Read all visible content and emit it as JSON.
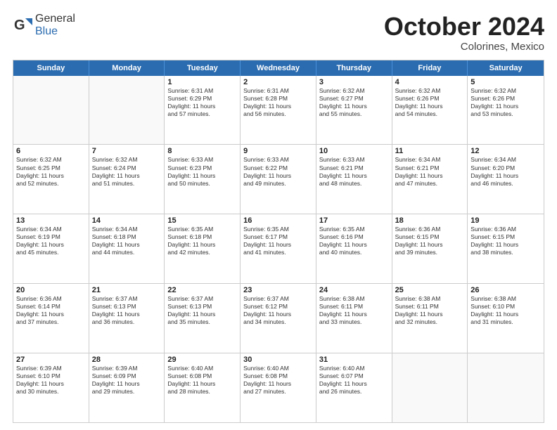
{
  "logo": {
    "general": "General",
    "blue": "Blue"
  },
  "header": {
    "month": "October 2024",
    "location": "Colorines, Mexico"
  },
  "weekdays": [
    "Sunday",
    "Monday",
    "Tuesday",
    "Wednesday",
    "Thursday",
    "Friday",
    "Saturday"
  ],
  "rows": [
    [
      {
        "day": "",
        "empty": true
      },
      {
        "day": "",
        "empty": true
      },
      {
        "day": "1",
        "line1": "Sunrise: 6:31 AM",
        "line2": "Sunset: 6:29 PM",
        "line3": "Daylight: 11 hours",
        "line4": "and 57 minutes."
      },
      {
        "day": "2",
        "line1": "Sunrise: 6:31 AM",
        "line2": "Sunset: 6:28 PM",
        "line3": "Daylight: 11 hours",
        "line4": "and 56 minutes."
      },
      {
        "day": "3",
        "line1": "Sunrise: 6:32 AM",
        "line2": "Sunset: 6:27 PM",
        "line3": "Daylight: 11 hours",
        "line4": "and 55 minutes."
      },
      {
        "day": "4",
        "line1": "Sunrise: 6:32 AM",
        "line2": "Sunset: 6:26 PM",
        "line3": "Daylight: 11 hours",
        "line4": "and 54 minutes."
      },
      {
        "day": "5",
        "line1": "Sunrise: 6:32 AM",
        "line2": "Sunset: 6:26 PM",
        "line3": "Daylight: 11 hours",
        "line4": "and 53 minutes."
      }
    ],
    [
      {
        "day": "6",
        "line1": "Sunrise: 6:32 AM",
        "line2": "Sunset: 6:25 PM",
        "line3": "Daylight: 11 hours",
        "line4": "and 52 minutes."
      },
      {
        "day": "7",
        "line1": "Sunrise: 6:32 AM",
        "line2": "Sunset: 6:24 PM",
        "line3": "Daylight: 11 hours",
        "line4": "and 51 minutes."
      },
      {
        "day": "8",
        "line1": "Sunrise: 6:33 AM",
        "line2": "Sunset: 6:23 PM",
        "line3": "Daylight: 11 hours",
        "line4": "and 50 minutes."
      },
      {
        "day": "9",
        "line1": "Sunrise: 6:33 AM",
        "line2": "Sunset: 6:22 PM",
        "line3": "Daylight: 11 hours",
        "line4": "and 49 minutes."
      },
      {
        "day": "10",
        "line1": "Sunrise: 6:33 AM",
        "line2": "Sunset: 6:21 PM",
        "line3": "Daylight: 11 hours",
        "line4": "and 48 minutes."
      },
      {
        "day": "11",
        "line1": "Sunrise: 6:34 AM",
        "line2": "Sunset: 6:21 PM",
        "line3": "Daylight: 11 hours",
        "line4": "and 47 minutes."
      },
      {
        "day": "12",
        "line1": "Sunrise: 6:34 AM",
        "line2": "Sunset: 6:20 PM",
        "line3": "Daylight: 11 hours",
        "line4": "and 46 minutes."
      }
    ],
    [
      {
        "day": "13",
        "line1": "Sunrise: 6:34 AM",
        "line2": "Sunset: 6:19 PM",
        "line3": "Daylight: 11 hours",
        "line4": "and 45 minutes."
      },
      {
        "day": "14",
        "line1": "Sunrise: 6:34 AM",
        "line2": "Sunset: 6:18 PM",
        "line3": "Daylight: 11 hours",
        "line4": "and 44 minutes."
      },
      {
        "day": "15",
        "line1": "Sunrise: 6:35 AM",
        "line2": "Sunset: 6:18 PM",
        "line3": "Daylight: 11 hours",
        "line4": "and 42 minutes."
      },
      {
        "day": "16",
        "line1": "Sunrise: 6:35 AM",
        "line2": "Sunset: 6:17 PM",
        "line3": "Daylight: 11 hours",
        "line4": "and 41 minutes."
      },
      {
        "day": "17",
        "line1": "Sunrise: 6:35 AM",
        "line2": "Sunset: 6:16 PM",
        "line3": "Daylight: 11 hours",
        "line4": "and 40 minutes."
      },
      {
        "day": "18",
        "line1": "Sunrise: 6:36 AM",
        "line2": "Sunset: 6:15 PM",
        "line3": "Daylight: 11 hours",
        "line4": "and 39 minutes."
      },
      {
        "day": "19",
        "line1": "Sunrise: 6:36 AM",
        "line2": "Sunset: 6:15 PM",
        "line3": "Daylight: 11 hours",
        "line4": "and 38 minutes."
      }
    ],
    [
      {
        "day": "20",
        "line1": "Sunrise: 6:36 AM",
        "line2": "Sunset: 6:14 PM",
        "line3": "Daylight: 11 hours",
        "line4": "and 37 minutes."
      },
      {
        "day": "21",
        "line1": "Sunrise: 6:37 AM",
        "line2": "Sunset: 6:13 PM",
        "line3": "Daylight: 11 hours",
        "line4": "and 36 minutes."
      },
      {
        "day": "22",
        "line1": "Sunrise: 6:37 AM",
        "line2": "Sunset: 6:13 PM",
        "line3": "Daylight: 11 hours",
        "line4": "and 35 minutes."
      },
      {
        "day": "23",
        "line1": "Sunrise: 6:37 AM",
        "line2": "Sunset: 6:12 PM",
        "line3": "Daylight: 11 hours",
        "line4": "and 34 minutes."
      },
      {
        "day": "24",
        "line1": "Sunrise: 6:38 AM",
        "line2": "Sunset: 6:11 PM",
        "line3": "Daylight: 11 hours",
        "line4": "and 33 minutes."
      },
      {
        "day": "25",
        "line1": "Sunrise: 6:38 AM",
        "line2": "Sunset: 6:11 PM",
        "line3": "Daylight: 11 hours",
        "line4": "and 32 minutes."
      },
      {
        "day": "26",
        "line1": "Sunrise: 6:38 AM",
        "line2": "Sunset: 6:10 PM",
        "line3": "Daylight: 11 hours",
        "line4": "and 31 minutes."
      }
    ],
    [
      {
        "day": "27",
        "line1": "Sunrise: 6:39 AM",
        "line2": "Sunset: 6:10 PM",
        "line3": "Daylight: 11 hours",
        "line4": "and 30 minutes."
      },
      {
        "day": "28",
        "line1": "Sunrise: 6:39 AM",
        "line2": "Sunset: 6:09 PM",
        "line3": "Daylight: 11 hours",
        "line4": "and 29 minutes."
      },
      {
        "day": "29",
        "line1": "Sunrise: 6:40 AM",
        "line2": "Sunset: 6:08 PM",
        "line3": "Daylight: 11 hours",
        "line4": "and 28 minutes."
      },
      {
        "day": "30",
        "line1": "Sunrise: 6:40 AM",
        "line2": "Sunset: 6:08 PM",
        "line3": "Daylight: 11 hours",
        "line4": "and 27 minutes."
      },
      {
        "day": "31",
        "line1": "Sunrise: 6:40 AM",
        "line2": "Sunset: 6:07 PM",
        "line3": "Daylight: 11 hours",
        "line4": "and 26 minutes."
      },
      {
        "day": "",
        "empty": true
      },
      {
        "day": "",
        "empty": true
      }
    ]
  ]
}
